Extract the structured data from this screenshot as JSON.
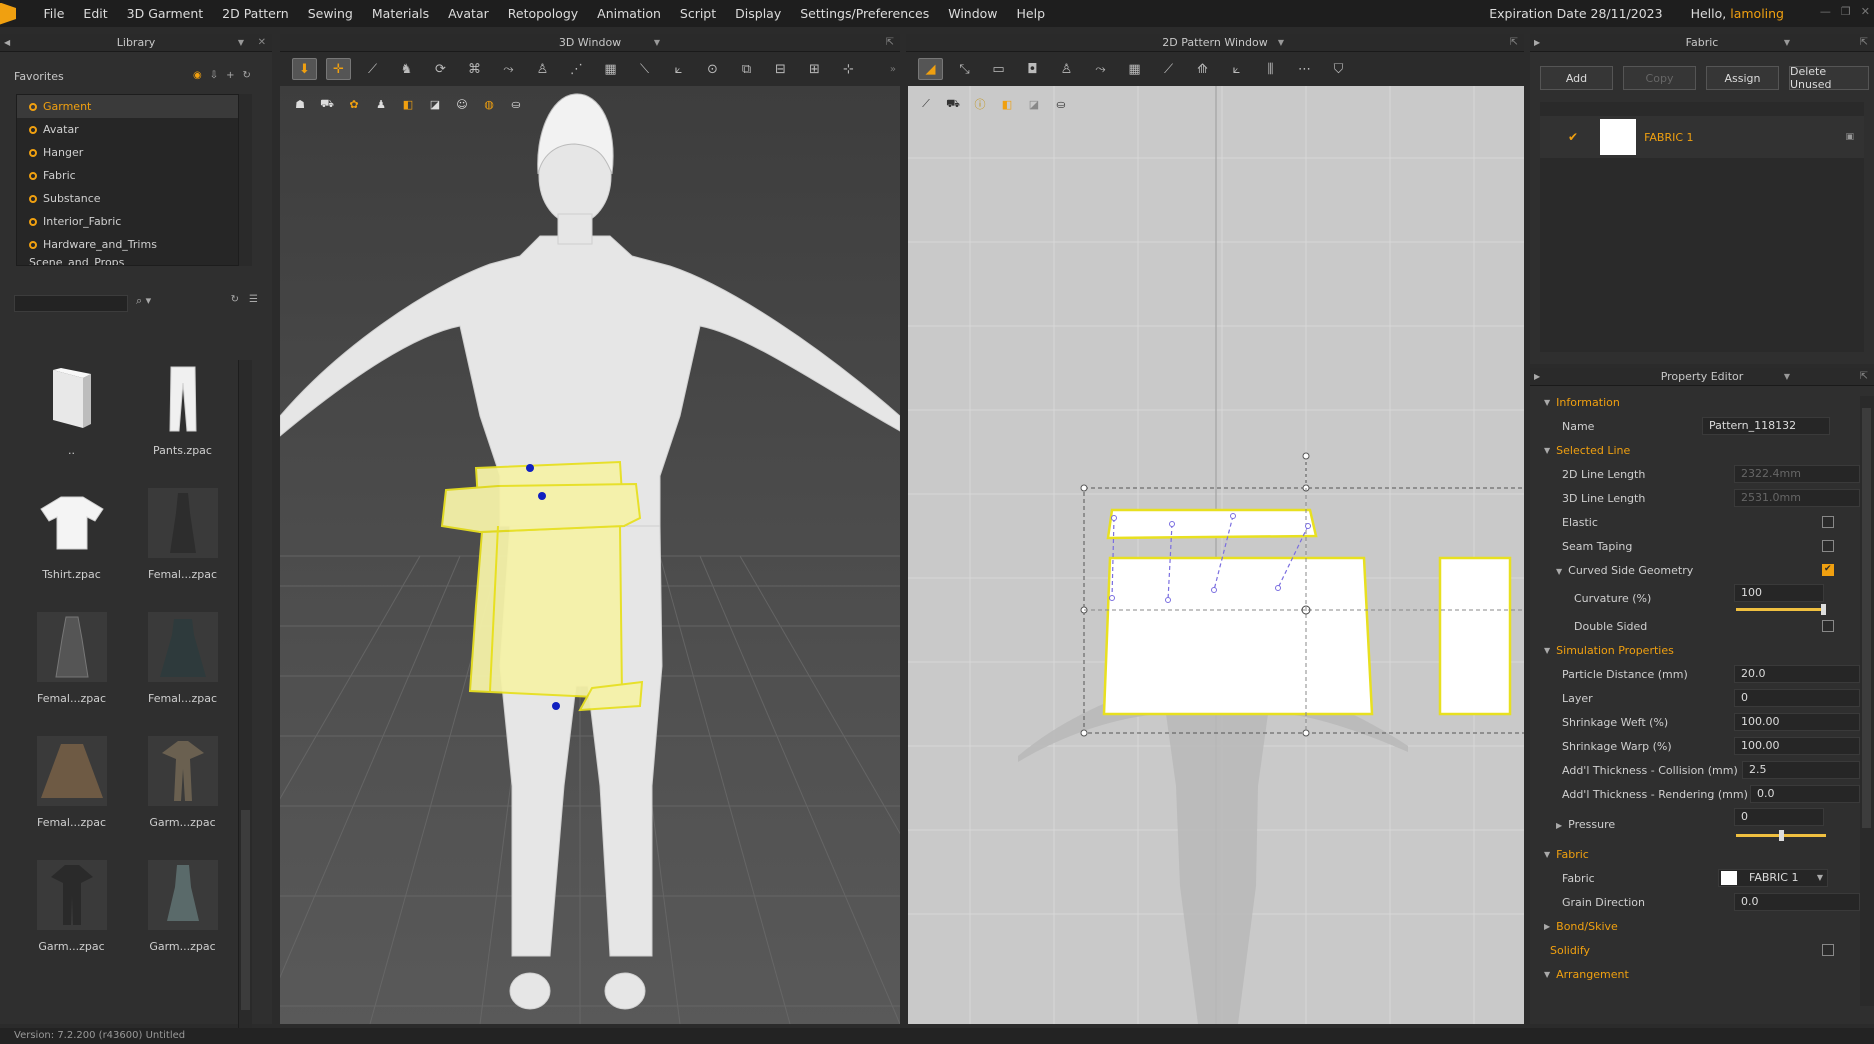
{
  "menubar": {
    "items": [
      "File",
      "Edit",
      "3D Garment",
      "2D Pattern",
      "Sewing",
      "Materials",
      "Avatar",
      "Retopology",
      "Animation",
      "Script",
      "Display",
      "Settings/Preferences",
      "Window",
      "Help"
    ],
    "expiration": "Expiration Date 28/11/2023",
    "hello": "Hello,",
    "username": "lamoling"
  },
  "library": {
    "header": "Library",
    "favorites_title": "Favorites",
    "favorites": [
      "Garment",
      "Avatar",
      "Hanger",
      "Fabric",
      "Substance",
      "Interior_Fabric",
      "Hardware_and_Trims",
      "Scene_and_Props"
    ],
    "selected_favorite": "Garment",
    "thumbnails": [
      "..",
      "Pants.zpac",
      "Tshirt.zpac",
      "Femal...zpac",
      "Femal...zpac",
      "Femal...zpac",
      "Femal...zpac",
      "Garm...zpac",
      "Garm...zpac",
      "Garm...zpac"
    ]
  },
  "win3d": {
    "header": "3D Window"
  },
  "win2d": {
    "header": "2D Pattern Window"
  },
  "fabric": {
    "header": "Fabric",
    "buttons": {
      "add": "Add",
      "copy": "Copy",
      "assign": "Assign",
      "delete_unused": "Delete Unused"
    },
    "item_name": "FABRIC 1"
  },
  "props": {
    "header": "Property Editor",
    "sections": {
      "information": "Information",
      "selected_line": "Selected Line",
      "simulation": "Simulation Properties",
      "fabric": "Fabric",
      "bond": "Bond/Skive",
      "solidify": "Solidify",
      "arrangement": "Arrangement"
    },
    "labels": {
      "name": "Name",
      "line2d": "2D Line Length",
      "line3d": "3D Line Length",
      "elastic": "Elastic",
      "seam_taping": "Seam Taping",
      "curved": "Curved Side Geometry",
      "curvature": "Curvature (%)",
      "double_sided": "Double Sided",
      "particle": "Particle Distance (mm)",
      "layer": "Layer",
      "weft": "Shrinkage Weft (%)",
      "warp": "Shrinkage Warp (%)",
      "thick_coll": "Add'l Thickness - Collision (mm)",
      "thick_rend": "Add'l Thickness - Rendering (mm)",
      "pressure": "Pressure",
      "fabric": "Fabric",
      "grain": "Grain Direction"
    },
    "values": {
      "name": "Pattern_118132",
      "line2d": "2322.4mm",
      "line3d": "2531.0mm",
      "curvature": "100",
      "particle": "20.0",
      "layer": "0",
      "weft": "100.00",
      "warp": "100.00",
      "thick_coll": "2.5",
      "thick_rend": "0.0",
      "pressure": "0",
      "fabric": "FABRIC 1",
      "grain": "0.0"
    },
    "curvature_level": 1.0,
    "pressure_level": 0.5
  },
  "status": {
    "text": "Version: 7.2.200 (r43600) Untitled"
  },
  "colors": {
    "accent": "#f0a010",
    "pattern_fill": "#f5f2a8",
    "pattern_outline": "#e8e020"
  }
}
